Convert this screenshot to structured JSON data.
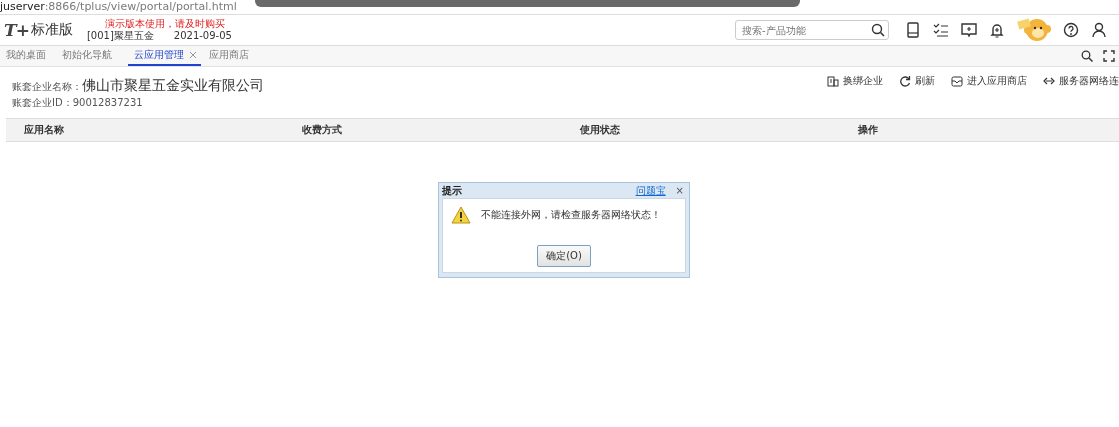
{
  "browser": {
    "url_host": "juserver",
    "url_rest": ":8866/tplus/view/portal/portal.html"
  },
  "header": {
    "logo": "T+",
    "edition": "标准版",
    "notice": "演示版本使用，请及时购买",
    "account": "[001]聚星五金",
    "date": "2021-09-05",
    "search": {
      "placeholder": "搜索-产品功能"
    }
  },
  "tabs": [
    {
      "label": "我的桌面",
      "selected": false,
      "closable": false
    },
    {
      "label": "初始化导航",
      "selected": false,
      "closable": false
    },
    {
      "label": "云应用管理",
      "selected": true,
      "closable": true
    },
    {
      "label": "应用商店",
      "selected": false,
      "closable": false
    }
  ],
  "company": {
    "name_label": "账套企业名称：",
    "name": "佛山市聚星五金实业有限公司",
    "id_label": "账套企业ID：",
    "id": "90012837231"
  },
  "actions": [
    {
      "kind": "rebind",
      "label": "换绑企业"
    },
    {
      "kind": "refresh",
      "label": "刷新"
    },
    {
      "kind": "store",
      "label": "进入应用商店"
    },
    {
      "kind": "network",
      "label": "服务器网络连"
    }
  ],
  "table": {
    "columns": [
      "应用名称",
      "收费方式",
      "使用状态",
      "操作"
    ]
  },
  "dialog": {
    "title": "提示",
    "help_link": "问题宝",
    "close": "×",
    "message": "不能连接外网，请检查服务器网络状态！",
    "button": "确定(O)"
  }
}
